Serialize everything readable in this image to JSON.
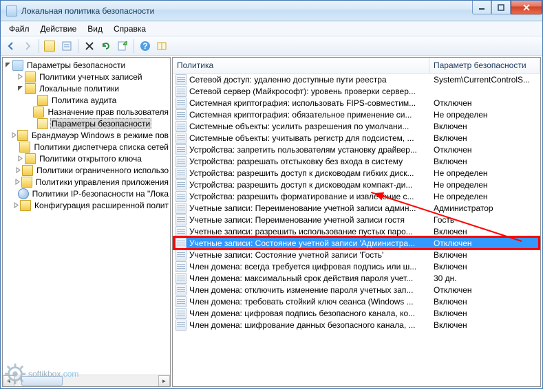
{
  "window": {
    "title": "Локальная политика безопасности"
  },
  "menu": [
    "Файл",
    "Действие",
    "Вид",
    "Справка"
  ],
  "tree": [
    {
      "d": 0,
      "t": "root",
      "e": "open",
      "icon": "sec",
      "label": "Параметры безопасности"
    },
    {
      "d": 1,
      "t": "node",
      "e": "closed",
      "icon": "folder",
      "label": "Политики учетных записей"
    },
    {
      "d": 1,
      "t": "node",
      "e": "open",
      "icon": "folder",
      "label": "Локальные политики"
    },
    {
      "d": 2,
      "t": "leaf",
      "icon": "folder",
      "label": "Политика аудита"
    },
    {
      "d": 2,
      "t": "leaf",
      "icon": "folder",
      "label": "Назначение прав пользователя"
    },
    {
      "d": 2,
      "t": "leaf",
      "icon": "folder-open",
      "label": "Параметры безопасности",
      "selected": true
    },
    {
      "d": 1,
      "t": "node",
      "e": "closed",
      "icon": "folder",
      "label": "Брандмауэр Windows в режиме пов"
    },
    {
      "d": 1,
      "t": "leaf",
      "icon": "folder",
      "label": "Политики диспетчера списка сетей"
    },
    {
      "d": 1,
      "t": "node",
      "e": "closed",
      "icon": "folder",
      "label": "Политики открытого ключа"
    },
    {
      "d": 1,
      "t": "node",
      "e": "closed",
      "icon": "folder",
      "label": "Политики ограниченного использо"
    },
    {
      "d": 1,
      "t": "node",
      "e": "closed",
      "icon": "folder",
      "label": "Политики управления приложения"
    },
    {
      "d": 1,
      "t": "leaf",
      "icon": "net",
      "label": "Политики IP-безопасности на \"Лока"
    },
    {
      "d": 1,
      "t": "node",
      "e": "closed",
      "icon": "folder",
      "label": "Конфигурация расширенной полит"
    }
  ],
  "list": {
    "columns": [
      "Политика",
      "Параметр безопасности"
    ],
    "rows": [
      {
        "p": "Сетевой доступ: удаленно доступные пути реестра",
        "v": "System\\CurrentControlS..."
      },
      {
        "p": "Сетевой сервер (Майкрософт): уровень проверки сервер...",
        "v": ""
      },
      {
        "p": "Системная криптография: использовать FIPS-совместим...",
        "v": "Отключен"
      },
      {
        "p": "Системная криптография: обязательное применение си...",
        "v": "Не определен"
      },
      {
        "p": "Системные объекты: усилить разрешения по умолчани...",
        "v": "Включен"
      },
      {
        "p": "Системные объекты: учитывать регистр для подсистем, ...",
        "v": "Включен"
      },
      {
        "p": "Устройства: запретить пользователям установку драйвер...",
        "v": "Отключен"
      },
      {
        "p": "Устройства: разрешать отстыковку без входа в систему",
        "v": "Включен"
      },
      {
        "p": "Устройства: разрешить доступ к дисководам гибких диск...",
        "v": "Не определен"
      },
      {
        "p": "Устройства: разрешить доступ к дисководам компакт-ди...",
        "v": "Не определен"
      },
      {
        "p": "Устройства: разрешить форматирование и извлечение с...",
        "v": "Не определен"
      },
      {
        "p": "Учетные записи: Переименование учетной записи админ...",
        "v": "Администратор"
      },
      {
        "p": "Учетные записи: Переименование учетной записи гостя",
        "v": "Гость"
      },
      {
        "p": "Учетные записи: разрешить использование пустых паро...",
        "v": "Включен"
      },
      {
        "p": "Учетные записи: Состояние учетной записи 'Администра...",
        "v": "Отключен",
        "sel": true
      },
      {
        "p": "Учетные записи: Состояние учетной записи 'Гость'",
        "v": "Включен"
      },
      {
        "p": "Член домена: всегда требуется цифровая подпись или ш...",
        "v": "Включен"
      },
      {
        "p": "Член домена: максимальный срок действия пароля учет...",
        "v": "30 дн."
      },
      {
        "p": "Член домена: отключить изменение пароля учетных зап...",
        "v": "Отключен"
      },
      {
        "p": "Член домена: требовать стойкий ключ сеанса (Windows ...",
        "v": "Включен"
      },
      {
        "p": "Член домена: цифровая подпись безопасного канала, ко...",
        "v": "Включен"
      },
      {
        "p": "Член домена: шифрование данных безопасного канала, ...",
        "v": "Включен"
      }
    ]
  },
  "brand": {
    "a": "softikbox",
    "b": ".com"
  }
}
